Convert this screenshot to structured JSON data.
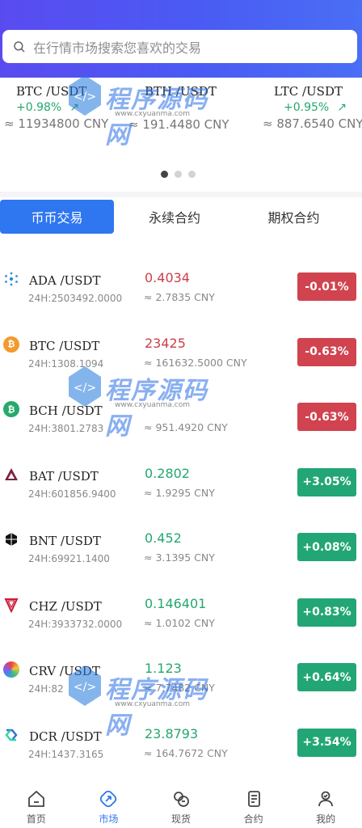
{
  "search": {
    "placeholder": "在行情市场搜索您喜欢的交易"
  },
  "tickers": [
    {
      "pair": "BTC /USDT",
      "change": "+0.98%",
      "cny": "≈ 11934800 CNY"
    },
    {
      "pair": "BTH /USDT",
      "change": "",
      "cny": "≈ 191.4480 CNY"
    },
    {
      "pair": "LTC /USDT",
      "change": "+0.95%",
      "cny": "≈ 887.6540 CNY"
    }
  ],
  "carousel": {
    "pages": 3,
    "active": 0
  },
  "tabs": [
    "币币交易",
    "永续合约",
    "期权合约"
  ],
  "rows": [
    {
      "pair": "ADA /USDT",
      "vol": "24H:2503492.0000",
      "price": "0.4034",
      "cny": "≈ 2.7835 CNY",
      "change": "-0.01%",
      "dir": "down",
      "icon": "ada-icon",
      "color": "#2a8fd8"
    },
    {
      "pair": "BTC /USDT",
      "vol": "24H:1308.1094",
      "price": "23425",
      "cny": "≈ 161632.5000 CNY",
      "change": "-0.63%",
      "dir": "down",
      "icon": "btc-icon",
      "color": "#f39a2c"
    },
    {
      "pair": "BCH /USDT",
      "vol": "24H:3801.2783",
      "price": "",
      "cny": "≈ 951.4920 CNY",
      "change": "-0.63%",
      "dir": "down",
      "icon": "bch-icon",
      "color": "#26a96c"
    },
    {
      "pair": "BAT /USDT",
      "vol": "24H:601856.9400",
      "price": "0.2802",
      "cny": "≈ 1.9295 CNY",
      "change": "+3.05%",
      "dir": "up",
      "icon": "bat-icon",
      "color": "#7a2244"
    },
    {
      "pair": "BNT /USDT",
      "vol": "24H:69921.1400",
      "price": "0.452",
      "cny": "≈ 3.1395 CNY",
      "change": "+0.08%",
      "dir": "up",
      "icon": "bnt-icon",
      "color": "#111111"
    },
    {
      "pair": "CHZ /USDT",
      "vol": "24H:3933732.0000",
      "price": "0.146401",
      "cny": "≈ 1.0102 CNY",
      "change": "+0.83%",
      "dir": "up",
      "icon": "chz-icon",
      "color": "#cd1b35"
    },
    {
      "pair": "CRV /USDT",
      "vol": "24H:82",
      "price": "1.123",
      "cny": "≈ 7.7482 CNY",
      "change": "+0.64%",
      "dir": "up",
      "icon": "crv-icon",
      "color": "#e85d9a"
    },
    {
      "pair": "DCR /USDT",
      "vol": "24H:1437.3165",
      "price": "23.8793",
      "cny": "≈ 164.7672 CNY",
      "change": "+3.54%",
      "dir": "up",
      "icon": "dcr-icon",
      "color": "#2e6fd8"
    }
  ],
  "nav": [
    {
      "label": "首页",
      "icon": "home-icon"
    },
    {
      "label": "市场",
      "icon": "market-icon",
      "active": true
    },
    {
      "label": "现货",
      "icon": "spot-icon"
    },
    {
      "label": "合约",
      "icon": "contract-icon"
    },
    {
      "label": "我的",
      "icon": "profile-icon"
    }
  ],
  "watermark": {
    "text": "程序源码网",
    "url": "www.cxyuanma.com"
  },
  "colors": {
    "up": "#22a675",
    "down": "#d0434f",
    "accent": "#2f77f0",
    "header": "#5a4bf0"
  }
}
